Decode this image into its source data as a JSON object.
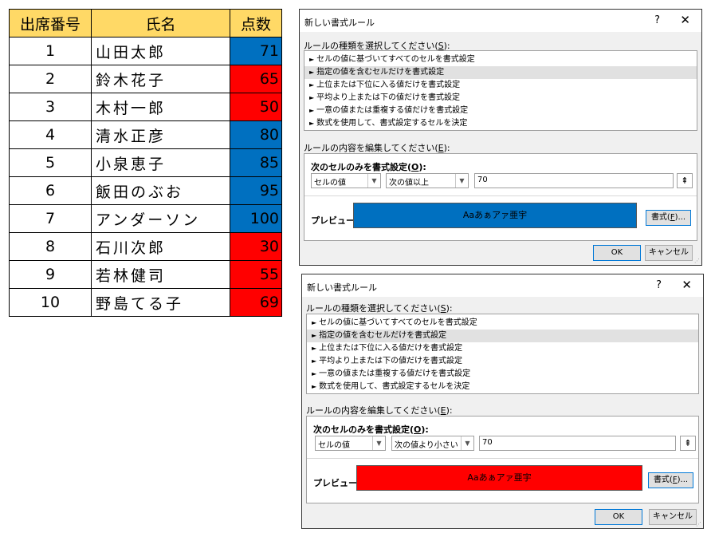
{
  "sheet": {
    "headers": [
      "出席番号",
      "氏名",
      "点数"
    ],
    "header_bg": "#ffd966",
    "rows": [
      {
        "num": "1",
        "name": "山田太郎",
        "score": "71",
        "fill": "#0070c0"
      },
      {
        "num": "2",
        "name": "鈴木花子",
        "score": "65",
        "fill": "#ff0000"
      },
      {
        "num": "3",
        "name": "木村一郎",
        "score": "50",
        "fill": "#ff0000"
      },
      {
        "num": "4",
        "name": "清水正彦",
        "score": "80",
        "fill": "#0070c0"
      },
      {
        "num": "5",
        "name": "小泉恵子",
        "score": "85",
        "fill": "#0070c0"
      },
      {
        "num": "6",
        "name": "飯田のぶお",
        "score": "95",
        "fill": "#0070c0"
      },
      {
        "num": "7",
        "name": "アンダーソン",
        "score": "100",
        "fill": "#0070c0"
      },
      {
        "num": "8",
        "name": "石川次郎",
        "score": "30",
        "fill": "#ff0000"
      },
      {
        "num": "9",
        "name": "若林健司",
        "score": "55",
        "fill": "#ff0000"
      },
      {
        "num": "10",
        "name": "野島てる子",
        "score": "69",
        "fill": "#ff0000"
      }
    ]
  },
  "dialogs": [
    {
      "title": "新しい書式ルール",
      "help": "?",
      "close": "✕",
      "rule_type_label": "ルールの種類を選択してください(",
      "rule_type_key": "S",
      "rule_types": [
        "セルの値に基づいてすべてのセルを書式設定",
        "指定の値を含むセルだけを書式設定",
        "上位または下位に入る値だけを書式設定",
        "平均より上または下の値だけを書式設定",
        "一意の値または重複する値だけを書式設定",
        "数式を使用して、書式設定するセルを決定"
      ],
      "selected_index": 1,
      "edit_label": "ルールの内容を編集してください(",
      "edit_key": "E",
      "panel_heading": "次のセルのみを書式設定(",
      "panel_key": "O",
      "field1": "セルの値",
      "operator": "次の値以上",
      "value": "70",
      "preview_label": "プレビュー:",
      "preview_text": "Aaあぁアァ亜宇",
      "preview_color": "#0070c0",
      "format_button": "書式(",
      "format_key": "F",
      "ok": "OK",
      "cancel": "キャンセル"
    },
    {
      "title": "新しい書式ルール",
      "help": "?",
      "close": "✕",
      "rule_type_label": "ルールの種類を選択してください(",
      "rule_type_key": "S",
      "rule_types": [
        "セルの値に基づいてすべてのセルを書式設定",
        "指定の値を含むセルだけを書式設定",
        "上位または下位に入る値だけを書式設定",
        "平均より上または下の値だけを書式設定",
        "一意の値または重複する値だけを書式設定",
        "数式を使用して、書式設定するセルを決定"
      ],
      "selected_index": 1,
      "edit_label": "ルールの内容を編集してください(",
      "edit_key": "E",
      "panel_heading": "次のセルのみを書式設定(",
      "panel_key": "O",
      "field1": "セルの値",
      "operator": "次の値より小さい",
      "value": "70",
      "preview_label": "プレビュー:",
      "preview_text": "Aaあぁアァ亜宇",
      "preview_color": "#ff0000",
      "format_button": "書式(",
      "format_key": "F",
      "ok": "OK",
      "cancel": "キャンセル"
    }
  ]
}
